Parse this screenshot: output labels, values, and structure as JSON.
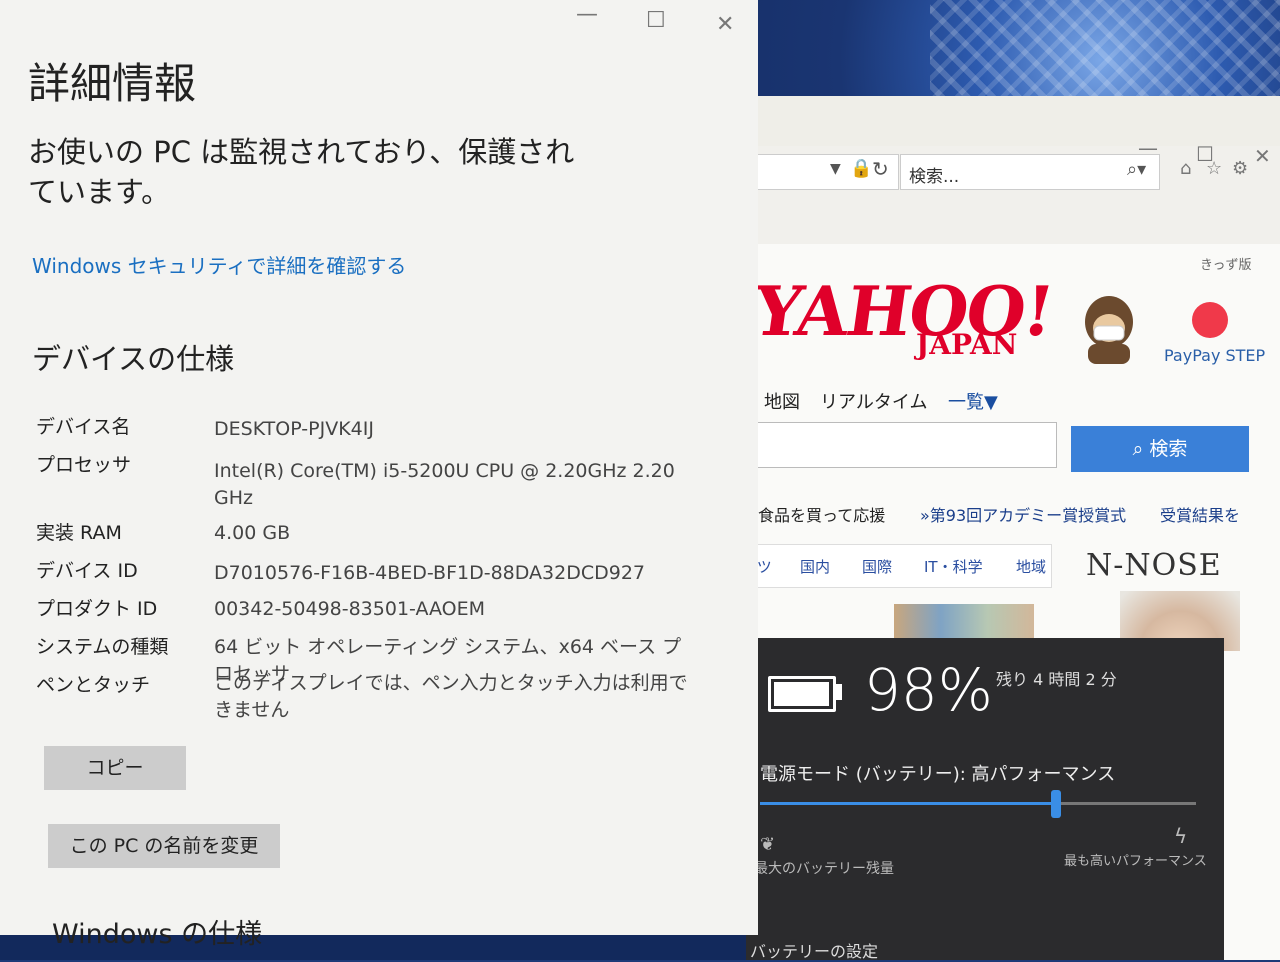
{
  "about": {
    "title": "詳細情報",
    "headline": "お使いの PC は監視されており、保護されています。",
    "security_link": "Windows セキュリティで詳細を確認する",
    "device_spec_heading": "デバイスの仕様",
    "specs": [
      {
        "label": "デバイス名",
        "value": "DESKTOP-PJVK4IJ"
      },
      {
        "label": "プロセッサ",
        "value": "Intel(R) Core(TM) i5-5200U CPU @ 2.20GHz   2.20 GHz"
      },
      {
        "label": "実装 RAM",
        "value": "4.00 GB"
      },
      {
        "label": "デバイス ID",
        "value": "D7010576-F16B-4BED-BF1D-88DA32DCD927"
      },
      {
        "label": "プロダクト ID",
        "value": "00342-50498-83501-AAOEM"
      },
      {
        "label": "システムの種類",
        "value": "64 ビット オペレーティング システム、x64 ベース プロセッサ"
      },
      {
        "label": "ペンとタッチ",
        "value": "このディスプレイでは、ペン入力とタッチ入力は利用できません"
      }
    ],
    "copy_button": "コピー",
    "rename_button": "この PC の名前を変更",
    "windows_spec_heading": "Windows の仕様"
  },
  "browser": {
    "search_placeholder": "検索...",
    "kisekae": "きっず版",
    "logo": "YAHOO!",
    "logo_sub": "JAPAN",
    "paypay_label": "PayPay STEP",
    "nav": [
      "地図",
      "リアルタイム",
      "一覧▼"
    ],
    "search_button": "検索",
    "news": [
      "い食品を買って応援",
      "»第93回アカデミー賞授賞式",
      "受賞結果を"
    ],
    "tabs": [
      "ーツ",
      "国内",
      "国際",
      "IT・科学",
      "地域"
    ],
    "ad": "N-NOSE"
  },
  "battery": {
    "percent": "98%",
    "remaining": "残り 4 時間 2 分",
    "power_mode": "電源モード (バッテリー): 高パフォーマンス",
    "slider_level": 0.68,
    "left_label": "最大のバッテリー残量",
    "right_label": "最も高いパフォーマンス",
    "settings_link": "バッテリーの設定"
  }
}
